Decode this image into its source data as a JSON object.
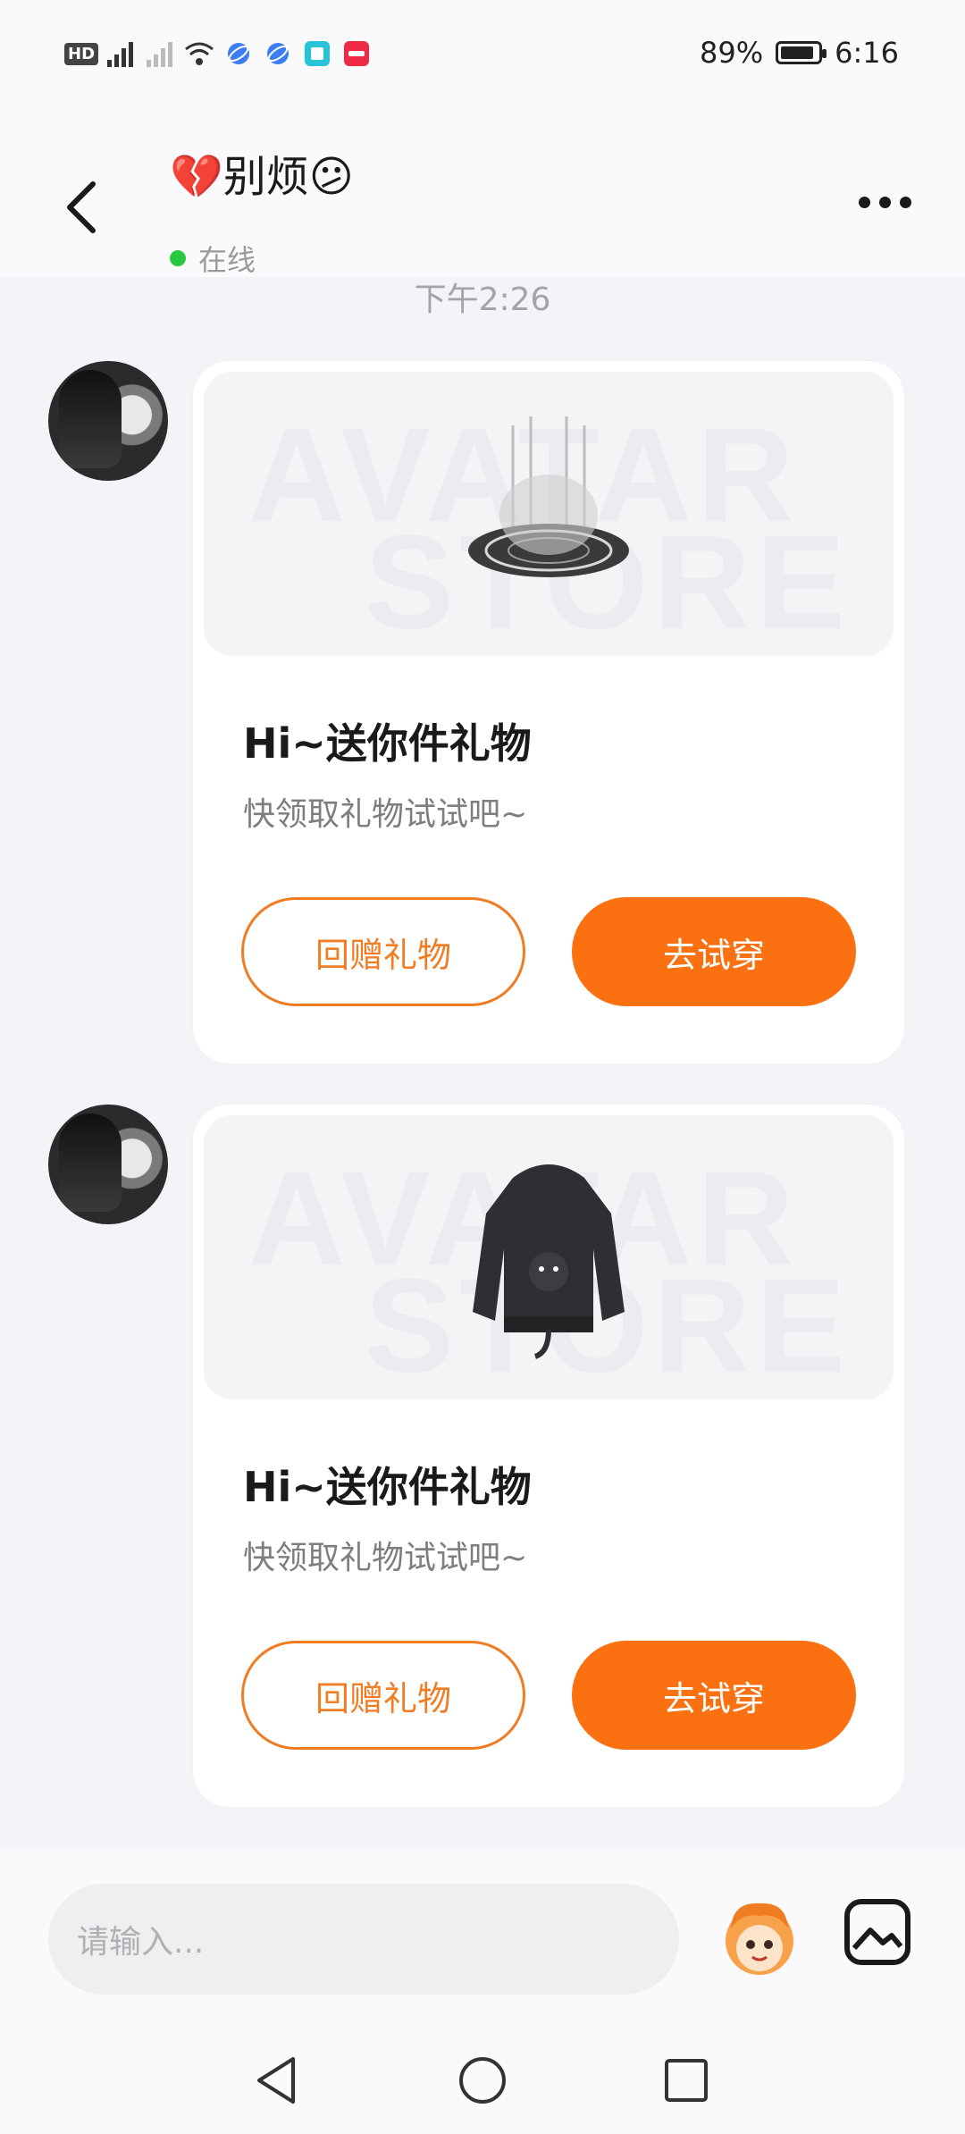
{
  "status_bar": {
    "battery_percent": "89%",
    "battery_level": 0.89,
    "time": "6:16",
    "left_icons": [
      "hd-icon",
      "signal-4g-icon",
      "signal-empty-icon",
      "wifi-icon",
      "app-icon-blue-1",
      "app-icon-blue-2",
      "book-app-icon",
      "red-app-icon"
    ]
  },
  "header": {
    "title": "💔别烦😕",
    "status": "在线"
  },
  "chat": {
    "timestamp": "下午2:26",
    "messages": [
      {
        "watermark_top": "AVATAR",
        "watermark_bottom": "STORE",
        "item": "ring-portal",
        "title": "Hi~送你件礼物",
        "subtitle": "快领取礼物试试吧~",
        "left_button": "回赠礼物",
        "right_button": "去试穿"
      },
      {
        "watermark_top": "AVATAR",
        "watermark_bottom": "STORE",
        "item": "black-hoodie",
        "title": "Hi~送你件礼物",
        "subtitle": "快领取礼物试试吧~",
        "left_button": "回赠礼物",
        "right_button": "去试穿"
      }
    ]
  },
  "input": {
    "placeholder": "请输入..."
  },
  "colors": {
    "accent": "#fb7112",
    "outline": "#f07c23",
    "online": "#28c840"
  }
}
